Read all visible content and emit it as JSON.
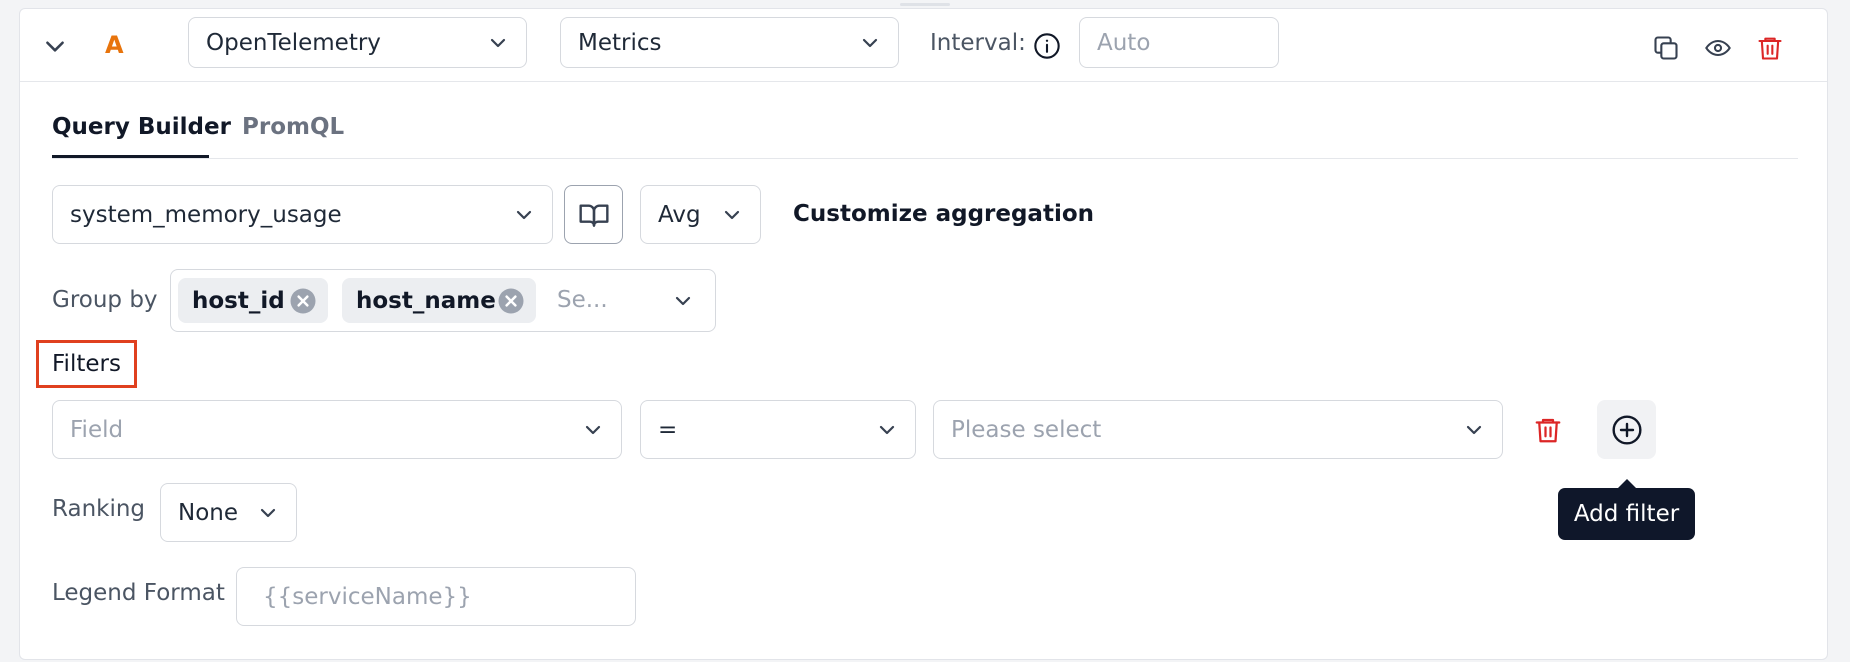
{
  "query": {
    "letter": "A",
    "source_value": "OpenTelemetry",
    "type_value": "Metrics",
    "interval_label": "Interval:",
    "interval_placeholder": "Auto"
  },
  "tabs": [
    {
      "label": "Query Builder",
      "active": true
    },
    {
      "label": "PromQL",
      "active": false
    }
  ],
  "metric": {
    "value": "system_memory_usage",
    "aggregation": "Avg",
    "customize_label": "Customize aggregation"
  },
  "group_by": {
    "label": "Group by",
    "chips": [
      "host_id",
      "host_name"
    ],
    "placeholder": "Se..."
  },
  "filters": {
    "label": "Filters",
    "field_placeholder": "Field",
    "operator": "=",
    "value_placeholder": "Please select",
    "tooltip": "Add filter"
  },
  "ranking": {
    "label": "Ranking",
    "value": "None"
  },
  "legend": {
    "label": "Legend Format",
    "placeholder": "{{serviceName}}"
  },
  "colors": {
    "accent_orange": "#e8740c",
    "danger_red": "#dc2626",
    "highlight_box": "#e0401f",
    "tooltip_bg": "#0f172a"
  }
}
